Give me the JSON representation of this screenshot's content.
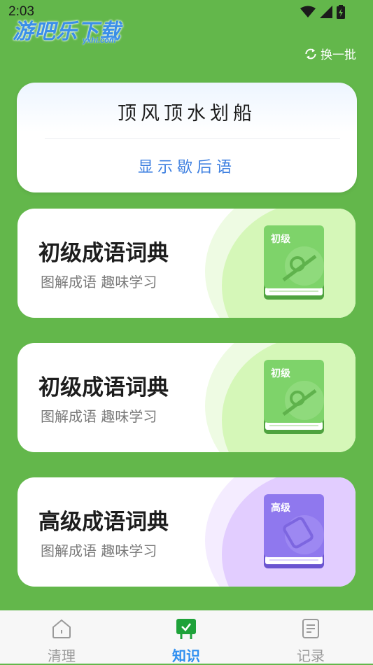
{
  "status_bar": {
    "time": "2:03"
  },
  "watermark": {
    "text": "游吧乐下载",
    "sub": "yxhi.com"
  },
  "header": {
    "refresh_label": "换一批"
  },
  "riddle": {
    "text": "顶风顶水划船",
    "show_label": "显示歇后语"
  },
  "dictionaries": [
    {
      "title": "初级成语词典",
      "subtitle": "图解成语 趣味学习",
      "book_label": "初级",
      "theme": "green"
    },
    {
      "title": "初级成语词典",
      "subtitle": "图解成语 趣味学习",
      "book_label": "初级",
      "theme": "green"
    },
    {
      "title": "高级成语词典",
      "subtitle": "图解成语 趣味学习",
      "book_label": "高级",
      "theme": "purple"
    }
  ],
  "tabs": [
    {
      "label": "清理",
      "icon": "home-icon",
      "active": false
    },
    {
      "label": "知识",
      "icon": "knowledge-icon",
      "active": true
    },
    {
      "label": "记录",
      "icon": "document-icon",
      "active": false
    }
  ],
  "colors": {
    "background": "#63b74b",
    "accent": "#2f8ff0",
    "link": "#3d7fe0",
    "green_book": "#7ed36a",
    "purple_book": "#8f78ee"
  }
}
